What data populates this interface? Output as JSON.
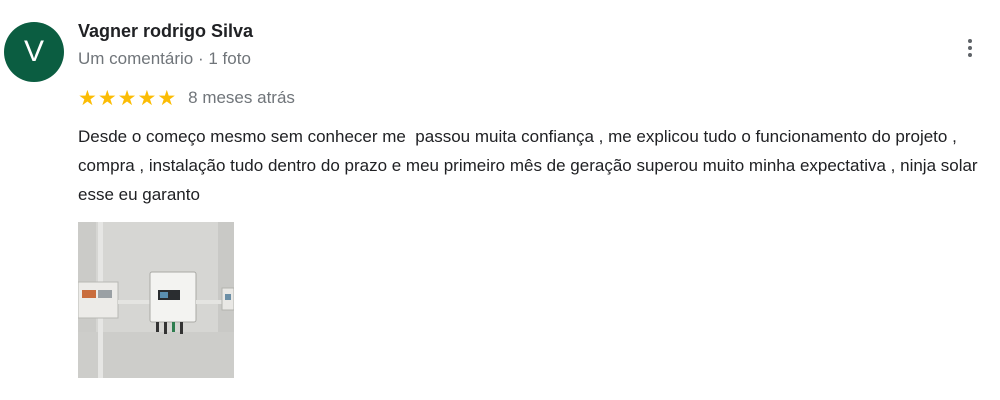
{
  "review": {
    "avatar_letter": "V",
    "author": "Vagner rodrigo Silva",
    "author_meta": "Um comentário · 1 foto",
    "star_glyph": "★",
    "star_color": "#fbbc04",
    "rating": 5,
    "date": "8 meses atrás",
    "text": "Desde o começo mesmo sem conhecer me  passou muita confiança , me explicou tudo o funcionamento do projeto , compra , instalação tudo dentro do prazo e meu primeiro mês de geração superou muito minha expectativa , ninja solar esse eu garanto",
    "avatar_color": "#0b5d41",
    "menu_icon": "more-vert-icon",
    "photo_description_icon": "photo-thumbnail"
  }
}
